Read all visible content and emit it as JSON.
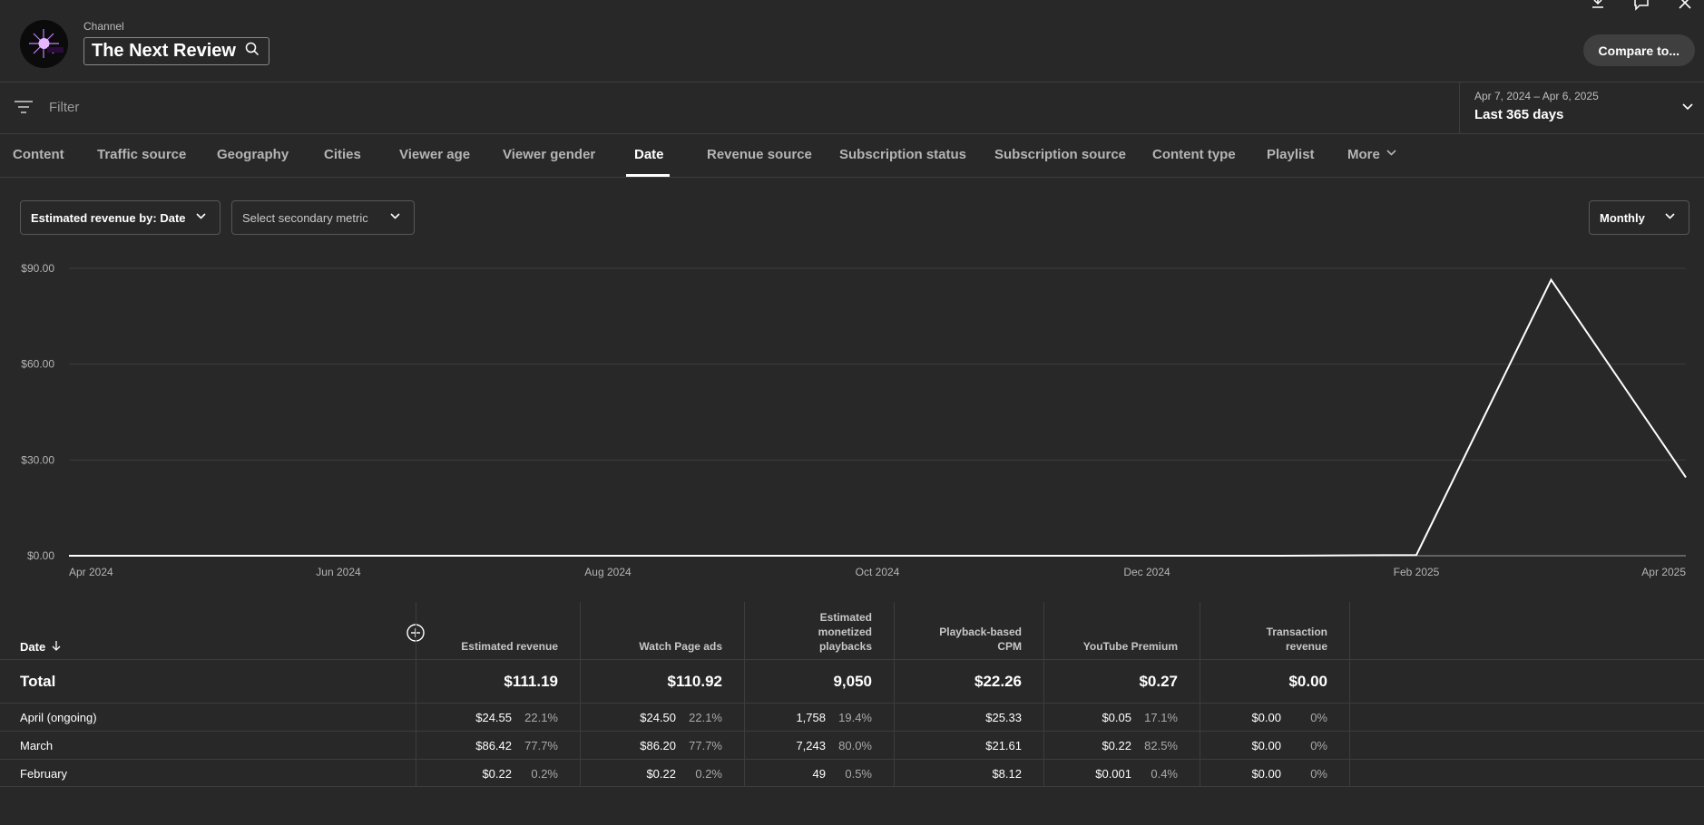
{
  "header": {
    "channel_label": "Channel",
    "channel_name": "The Next Review",
    "compare_label": "Compare to..."
  },
  "filter": {
    "placeholder": "Filter"
  },
  "date_selector": {
    "range": "Apr 7, 2024 – Apr 6, 2025",
    "period": "Last 365 days"
  },
  "tabs": [
    {
      "label": "Content"
    },
    {
      "label": "Traffic source"
    },
    {
      "label": "Geography"
    },
    {
      "label": "Cities"
    },
    {
      "label": "Viewer age"
    },
    {
      "label": "Viewer gender"
    },
    {
      "label": "Date"
    },
    {
      "label": "Revenue source"
    },
    {
      "label": "Subscription status"
    },
    {
      "label": "Subscription source"
    },
    {
      "label": "Content type"
    },
    {
      "label": "Playlist"
    },
    {
      "label": "More"
    }
  ],
  "active_tab": "Date",
  "controls": {
    "primary_metric": "Estimated revenue by: Date",
    "secondary_metric": "Select secondary metric",
    "granularity": "Monthly"
  },
  "chart_data": {
    "type": "line",
    "x": [
      "Apr 2024",
      "May 2024",
      "Jun 2024",
      "Jul 2024",
      "Aug 2024",
      "Sep 2024",
      "Oct 2024",
      "Nov 2024",
      "Dec 2024",
      "Jan 2025",
      "Feb 2025",
      "Mar 2025",
      "Apr 2025"
    ],
    "y": [
      0,
      0,
      0,
      0,
      0,
      0,
      0,
      0,
      0,
      0,
      0.22,
      86.42,
      24.55
    ],
    "x_tick_labels": [
      "Apr 2024",
      "Jun 2024",
      "Aug 2024",
      "Oct 2024",
      "Dec 2024",
      "Feb 2025",
      "Apr 2025"
    ],
    "y_tick_labels": [
      "$0.00",
      "$30.00",
      "$60.00",
      "$90.00"
    ],
    "ylim": [
      0,
      90
    ],
    "grid": true,
    "line_color": "#ffffff"
  },
  "table": {
    "date_header": "Date",
    "columns": [
      {
        "label": [
          "Estimated revenue"
        ]
      },
      {
        "label": [
          "Watch Page ads"
        ]
      },
      {
        "label": [
          "Estimated",
          "monetized",
          "playbacks"
        ]
      },
      {
        "label": [
          "Playback-based",
          "CPM"
        ]
      },
      {
        "label": [
          "YouTube Premium"
        ]
      },
      {
        "label": [
          "Transaction",
          "revenue"
        ]
      }
    ],
    "total": {
      "label": "Total",
      "values": [
        "$111.19",
        "$110.92",
        "9,050",
        "$22.26",
        "$0.27",
        "$0.00"
      ]
    },
    "rows": [
      {
        "label": "April (ongoing)",
        "cells": [
          [
            "$24.55",
            "22.1%"
          ],
          [
            "$24.50",
            "22.1%"
          ],
          [
            "1,758",
            "19.4%"
          ],
          [
            "$25.33",
            ""
          ],
          [
            "$0.05",
            "17.1%"
          ],
          [
            "$0.00",
            "0%"
          ]
        ]
      },
      {
        "label": "March",
        "cells": [
          [
            "$86.42",
            "77.7%"
          ],
          [
            "$86.20",
            "77.7%"
          ],
          [
            "7,243",
            "80.0%"
          ],
          [
            "$21.61",
            ""
          ],
          [
            "$0.22",
            "82.5%"
          ],
          [
            "$0.00",
            "0%"
          ]
        ]
      },
      {
        "label": "February",
        "cells": [
          [
            "$0.22",
            "0.2%"
          ],
          [
            "$0.22",
            "0.2%"
          ],
          [
            "49",
            "0.5%"
          ],
          [
            "$8.12",
            ""
          ],
          [
            "$0.001",
            "0.4%"
          ],
          [
            "$0.00",
            "0%"
          ]
        ]
      }
    ]
  }
}
